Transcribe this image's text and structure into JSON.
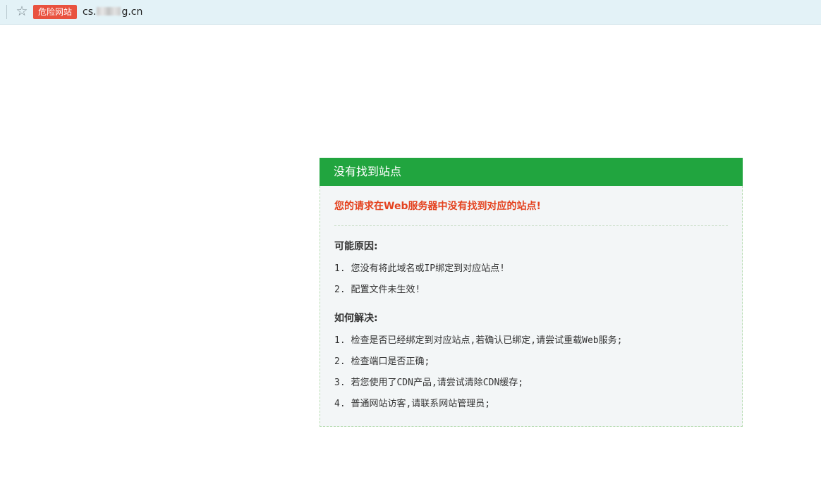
{
  "browser": {
    "star_icon": "star-outline-icon",
    "danger_badge": "危险网站",
    "url_prefix": "cs.",
    "url_suffix": "g.cn"
  },
  "page": {
    "header_title": "没有找到站点",
    "error_message": "您的请求在Web服务器中没有找到对应的站点!",
    "reasons_title": "可能原因:",
    "reasons": [
      "1. 您没有将此域名或IP绑定到对应站点!",
      "2. 配置文件未生效!"
    ],
    "solutions_title": "如何解决:",
    "solutions": [
      "1. 检查是否已经绑定到对应站点,若确认已绑定,请尝试重载Web服务;",
      "2. 检查端口是否正确;",
      "3. 若您使用了CDN产品,请尝试清除CDN缓存;",
      "4. 普通网站访客,请联系网站管理员;"
    ]
  },
  "colors": {
    "header_green": "#21a53f",
    "error_red": "#e4421f",
    "danger_badge": "#e9523f",
    "address_bar": "#e3f2f7"
  }
}
